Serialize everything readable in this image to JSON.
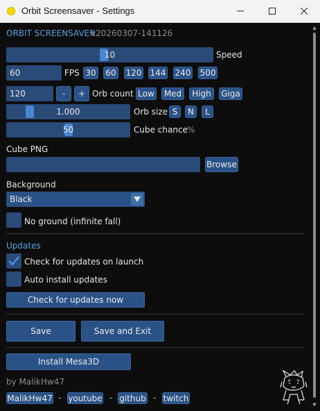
{
  "window": {
    "title": "Orbit Screensaver - Settings"
  },
  "header": {
    "app_name": "ORBIT SCREENSAVER",
    "version": "v20260307-141126"
  },
  "speed": {
    "value": "10",
    "level": 0.47,
    "label": "Speed"
  },
  "fps": {
    "value": "60",
    "label": "FPS",
    "presets": [
      "30",
      "60",
      "120",
      "144",
      "240",
      "500"
    ]
  },
  "orb_count": {
    "value": "120",
    "minus": "-",
    "plus": "+",
    "label": "Orb count",
    "presets": [
      "Low",
      "Med",
      "High",
      "Giga"
    ]
  },
  "orb_size": {
    "value": "1.000",
    "level": 0.17,
    "label": "Orb size",
    "presets": [
      "S",
      "N",
      "L"
    ]
  },
  "cube_chance": {
    "value": "50",
    "level": 0.5,
    "label": "Cube chance",
    "unit": "%"
  },
  "cube_png": {
    "label": "Cube PNG",
    "value": "",
    "browse_label": "Browse"
  },
  "background": {
    "label": "Background",
    "selected": "Black"
  },
  "no_ground": {
    "label": "No ground (infinite fall)",
    "checked": false
  },
  "updates": {
    "section_title": "Updates",
    "check_on_launch_label": "Check for updates on launch",
    "check_on_launch": true,
    "auto_install_label": "Auto install updates",
    "auto_install": false,
    "check_now_label": "Check for updates now"
  },
  "actions": {
    "save_label": "Save",
    "save_exit_label": "Save and Exit"
  },
  "mesa": {
    "install_label": "Install Mesa3D"
  },
  "footer": {
    "author": "by MalikHw47",
    "links": [
      "MalikHw47",
      "youtube",
      "github",
      "twitch"
    ],
    "separator": "-"
  },
  "colors": {
    "accent": "#5aa0e0",
    "button": "#2b5287",
    "field": "#2a4a78",
    "background": "#0d0d0d",
    "slider_thumb": "#4a86d0"
  }
}
